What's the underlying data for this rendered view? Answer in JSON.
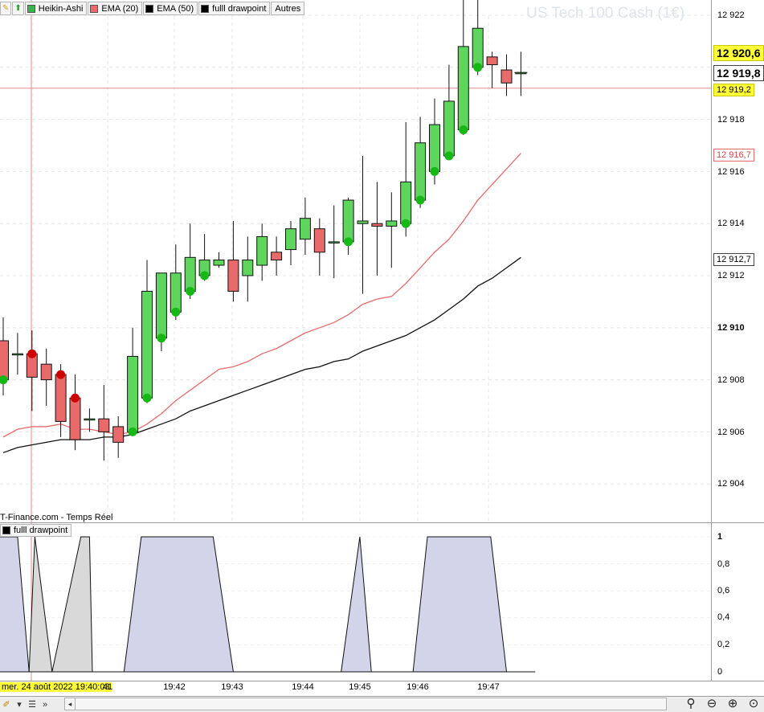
{
  "toolbar": {
    "items": [
      {
        "label": "Heikin-Ashi",
        "color": "#3cb44b"
      },
      {
        "label": "EMA (20)",
        "color": "#e86a6a"
      },
      {
        "label": "EMA (50)",
        "color": "#000000"
      },
      {
        "label": "fulll drawpoint",
        "color": "#000000"
      }
    ],
    "more_label": "Autres"
  },
  "watermark": "US Tech 100 Cash (1€)",
  "source_label": "T-Finance.com - Temps Réel",
  "indicator_tab": "fulll drawpoint",
  "price_axis": {
    "ticks": [
      "12 922",
      "12 918",
      "12 916",
      "12 914",
      "12 912",
      "12 910",
      "12 908",
      "12 906",
      "12 904"
    ],
    "labels": {
      "last_high": "12 920,6",
      "last_close": "12 919,8",
      "crosshair": "12 919,2",
      "ema20": "12 916,7",
      "ema50": "12 912,7"
    }
  },
  "indicator_axis": {
    "ticks": [
      "1",
      "0,8",
      "0,6",
      "0,4",
      "0,2",
      "0"
    ]
  },
  "time_axis": {
    "highlight": "mer. 24 août 2022 19:40:03",
    "ticks": [
      "41",
      "19:42",
      "19:43",
      "19:44",
      "19:45",
      "19:46",
      "19:47"
    ]
  },
  "colors": {
    "bull": "#5ed65e",
    "bear": "#e86a6a",
    "ema20": "#e86a6a",
    "ema50": "#111111",
    "dot_bull": "#16b816",
    "dot_bear": "#cc0000",
    "fill_blue": "#d3d4ea",
    "fill_gray": "#d9d9d9",
    "crosshair": "#e88a8a",
    "label_yellow": "#ffff3a"
  },
  "chart_data": {
    "type": "candlestick",
    "ylim": [
      12903,
      12923.5
    ],
    "candles": [
      {
        "o": 12909.5,
        "h": 12910.4,
        "l": 12907.4,
        "c": 12908.0,
        "dot": "bull"
      },
      {
        "o": 12909.0,
        "h": 12909.8,
        "l": 12908.2,
        "c": 12909.0,
        "dot": null
      },
      {
        "o": 12909.0,
        "h": 12909.9,
        "l": 12906.8,
        "c": 12908.1,
        "dot": "bear"
      },
      {
        "o": 12908.6,
        "h": 12909.2,
        "l": 12907.0,
        "c": 12908.0,
        "dot": null
      },
      {
        "o": 12908.2,
        "h": 12908.6,
        "l": 12905.8,
        "c": 12906.4,
        "dot": "bear"
      },
      {
        "o": 12907.3,
        "h": 12908.2,
        "l": 12905.3,
        "c": 12905.7,
        "dot": "bear"
      },
      {
        "o": 12906.5,
        "h": 12906.9,
        "l": 12906.0,
        "c": 12906.5,
        "dot": null
      },
      {
        "o": 12906.5,
        "h": 12907.8,
        "l": 12904.9,
        "c": 12906.0,
        "dot": null
      },
      {
        "o": 12906.2,
        "h": 12906.6,
        "l": 12905.0,
        "c": 12905.6,
        "dot": null
      },
      {
        "o": 12906.0,
        "h": 12910.0,
        "l": 12905.9,
        "c": 12908.9,
        "dot": "bull"
      },
      {
        "o": 12907.3,
        "h": 12912.6,
        "l": 12907.1,
        "c": 12911.4,
        "dot": "bull"
      },
      {
        "o": 12909.6,
        "h": 12912.0,
        "l": 12909.1,
        "c": 12912.1,
        "dot": "bull"
      },
      {
        "o": 12910.6,
        "h": 12913.2,
        "l": 12910.3,
        "c": 12912.1,
        "dot": "bull"
      },
      {
        "o": 12911.4,
        "h": 12914.0,
        "l": 12911.1,
        "c": 12912.7,
        "dot": "bull"
      },
      {
        "o": 12912.0,
        "h": 12913.6,
        "l": 12911.8,
        "c": 12912.6,
        "dot": "bull"
      },
      {
        "o": 12912.4,
        "h": 12912.9,
        "l": 12912.3,
        "c": 12912.6,
        "dot": null
      },
      {
        "o": 12912.6,
        "h": 12914.1,
        "l": 12911.0,
        "c": 12911.4,
        "dot": null
      },
      {
        "o": 12912.0,
        "h": 12913.5,
        "l": 12911.0,
        "c": 12912.6,
        "dot": null
      },
      {
        "o": 12912.4,
        "h": 12914.0,
        "l": 12911.8,
        "c": 12913.5,
        "dot": null
      },
      {
        "o": 12912.9,
        "h": 12913.5,
        "l": 12912.0,
        "c": 12912.6,
        "dot": null
      },
      {
        "o": 12913.0,
        "h": 12914.1,
        "l": 12912.4,
        "c": 12913.8,
        "dot": null
      },
      {
        "o": 12913.4,
        "h": 12915.0,
        "l": 12912.8,
        "c": 12914.2,
        "dot": null
      },
      {
        "o": 12913.8,
        "h": 12914.2,
        "l": 12912.0,
        "c": 12912.9,
        "dot": null
      },
      {
        "o": 12913.3,
        "h": 12914.7,
        "l": 12911.9,
        "c": 12913.3,
        "dot": null
      },
      {
        "o": 12913.3,
        "h": 12915.0,
        "l": 12912.8,
        "c": 12914.9,
        "dot": "bull"
      },
      {
        "o": 12914.0,
        "h": 12916.6,
        "l": 12911.3,
        "c": 12914.1,
        "dot": null
      },
      {
        "o": 12914.0,
        "h": 12915.6,
        "l": 12912.0,
        "c": 12913.9,
        "dot": null
      },
      {
        "o": 12913.9,
        "h": 12915.2,
        "l": 12912.3,
        "c": 12914.1,
        "dot": null
      },
      {
        "o": 12914.0,
        "h": 12917.9,
        "l": 12913.5,
        "c": 12915.6,
        "dot": "bull"
      },
      {
        "o": 12914.9,
        "h": 12918.1,
        "l": 12914.6,
        "c": 12917.1,
        "dot": "bull"
      },
      {
        "o": 12916.0,
        "h": 12918.8,
        "l": 12915.5,
        "c": 12917.8,
        "dot": "bull"
      },
      {
        "o": 12916.6,
        "h": 12920.1,
        "l": 12916.5,
        "c": 12918.7,
        "dot": "bull"
      },
      {
        "o": 12917.6,
        "h": 12922.9,
        "l": 12917.4,
        "c": 12920.8,
        "dot": "bull"
      },
      {
        "o": 12920.0,
        "h": 12922.8,
        "l": 12919.7,
        "c": 12921.5,
        "dot": "bull"
      },
      {
        "o": 12920.4,
        "h": 12920.6,
        "l": 12919.2,
        "c": 12920.1,
        "dot": null
      },
      {
        "o": 12919.9,
        "h": 12920.5,
        "l": 12918.9,
        "c": 12919.4,
        "dot": null
      },
      {
        "o": 12919.8,
        "h": 12920.6,
        "l": 12918.9,
        "c": 12919.8,
        "dot": null
      }
    ],
    "ema20": [
      12905.8,
      12906.1,
      12906.2,
      12906.2,
      12906.3,
      12906.1,
      12906.1,
      12906.0,
      12905.9,
      12906.0,
      12906.3,
      12906.7,
      12907.2,
      12907.6,
      12908.0,
      12908.4,
      12908.5,
      12908.7,
      12909.0,
      12909.2,
      12909.5,
      12909.8,
      12910.0,
      12910.2,
      12910.5,
      12910.9,
      12911.1,
      12911.2,
      12911.7,
      12912.3,
      12912.9,
      12913.4,
      12914.1,
      12914.9,
      12915.5,
      12916.1,
      12916.7
    ],
    "ema50": [
      12905.2,
      12905.4,
      12905.5,
      12905.6,
      12905.7,
      12905.7,
      12905.7,
      12905.8,
      12905.8,
      12905.9,
      12906.1,
      12906.3,
      12906.5,
      12906.8,
      12907.0,
      12907.2,
      12907.4,
      12907.6,
      12907.8,
      12908.0,
      12908.2,
      12908.4,
      12908.5,
      12908.7,
      12908.8,
      12909.1,
      12909.3,
      12909.5,
      12909.7,
      12910.0,
      12910.3,
      12910.7,
      12911.1,
      12911.6,
      12911.9,
      12912.3,
      12912.7
    ],
    "indicator": {
      "ylim": [
        0,
        1
      ],
      "segments": [
        {
          "shape": "pulse",
          "fill": "blue",
          "x0": -0.8,
          "x1": -0.3,
          "x2": 1.0,
          "x3": 1.8
        },
        {
          "shape": "spike",
          "fill": "gray",
          "x0": 1.8,
          "x2": 2.2,
          "x3": 3.4
        },
        {
          "shape": "pulse",
          "fill": "gray",
          "x0": 3.4,
          "x1": 5.4,
          "x2": 6.0,
          "x3": 6.2
        },
        {
          "shape": "pulse",
          "fill": "blue",
          "x0": 8.4,
          "x1": 9.6,
          "x2": 14.6,
          "x3": 16.0
        },
        {
          "shape": "spike",
          "fill": "blue",
          "x0": 23.5,
          "x2": 24.8,
          "x3": 25.6
        },
        {
          "shape": "pulse",
          "fill": "blue",
          "x0": 28.5,
          "x1": 29.5,
          "x2": 33.9,
          "x3": 35.0
        }
      ],
      "baseline_x": [
        0,
        37.0
      ]
    }
  }
}
